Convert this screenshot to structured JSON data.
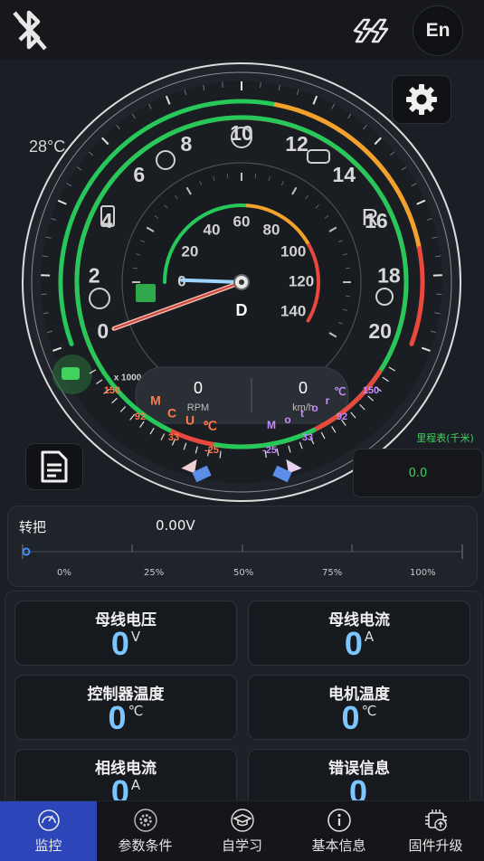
{
  "temperature": "28°C",
  "language_button": "En",
  "gauge": {
    "outer_ticks": [
      "0",
      "2",
      "4",
      "6",
      "8",
      "10",
      "12",
      "14",
      "16",
      "18",
      "20"
    ],
    "outer_multiplier": "x 1000",
    "gear_r": "R",
    "inner_ticks": [
      "0",
      "20",
      "40",
      "60",
      "80",
      "100",
      "120",
      "140"
    ],
    "gear_d": "D",
    "rpm_value": "0",
    "rpm_unit": "RPM",
    "speed_value": "0",
    "speed_unit": "km/h",
    "mcu_label": [
      "M",
      "C",
      "U",
      "℃"
    ],
    "mcu_scale": [
      "150",
      "92",
      "33",
      "-25"
    ],
    "motor_label": [
      "M",
      "o",
      "t",
      "o",
      "r",
      "℃"
    ],
    "motor_scale": [
      "150",
      "92",
      "33",
      "-25"
    ]
  },
  "odometer": {
    "title": "里程表(千米)",
    "value": "0.0"
  },
  "throttle": {
    "label": "转把",
    "value": "0.00V",
    "level": 0,
    "ticks": [
      "0%",
      "25%",
      "50%",
      "75%",
      "100%"
    ]
  },
  "metrics": [
    {
      "title": "母线电压",
      "value": "0",
      "unit": "V"
    },
    {
      "title": "母线电流",
      "value": "0",
      "unit": "A"
    },
    {
      "title": "控制器温度",
      "value": "0",
      "unit": "℃"
    },
    {
      "title": "电机温度",
      "value": "0",
      "unit": "℃"
    },
    {
      "title": "相线电流",
      "value": "0",
      "unit": "A"
    },
    {
      "title": "错误信息",
      "value": "0",
      "unit": ""
    }
  ],
  "nav": [
    {
      "label": "监控",
      "icon": "gauge-icon"
    },
    {
      "label": "参数条件",
      "icon": "settings-icon"
    },
    {
      "label": "自学习",
      "icon": "learning-cap-icon"
    },
    {
      "label": "基本信息",
      "icon": "info-icon"
    },
    {
      "label": "固件升级",
      "icon": "chip-upgrade-icon"
    }
  ],
  "colors": {
    "accent": "#2c45b8",
    "green": "#27c85a",
    "orange": "#f2a22c",
    "red": "#e9483d",
    "value_blue": "#7cc6ff"
  }
}
